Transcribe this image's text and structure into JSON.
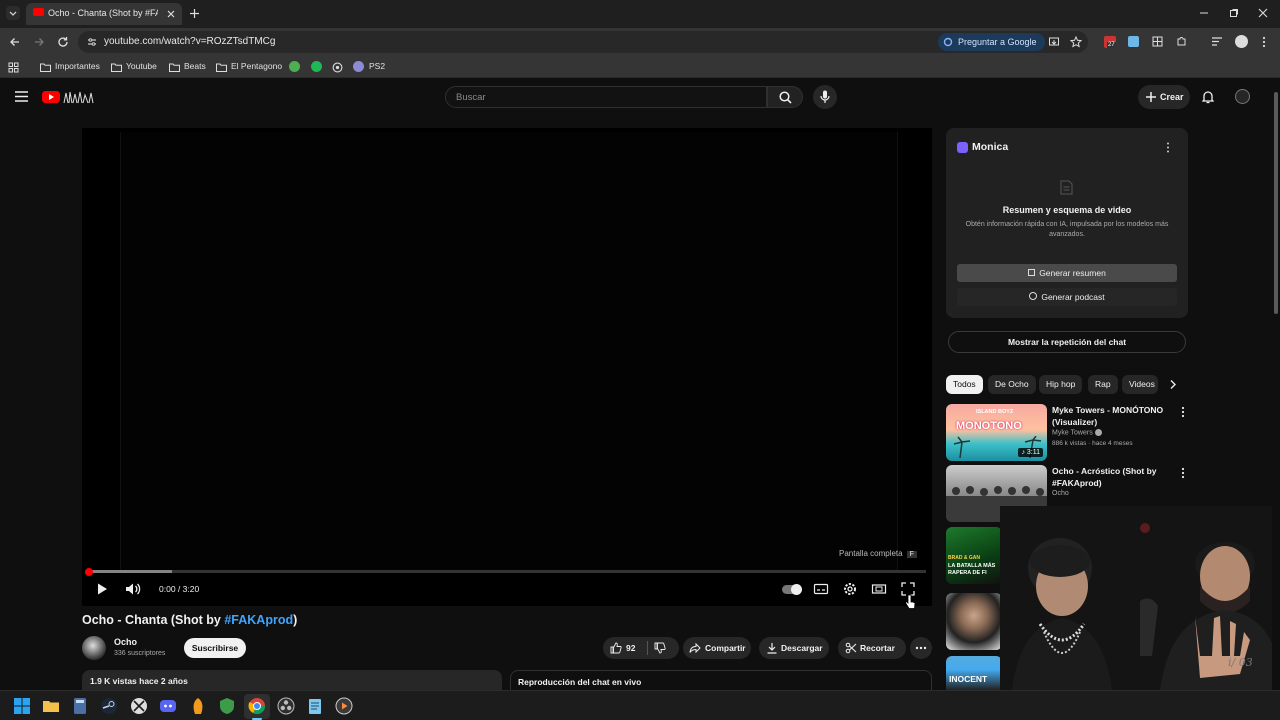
{
  "browser": {
    "tab_title": "Ocho - Chanta (Shot by #FAKAprod)",
    "url": "youtube.com/watch?v=ROzZTsdTMCg",
    "ask_google": "Preguntar a Google",
    "ext_badge": "27",
    "bookmarks": [
      "Importantes",
      "Youtube",
      "Beats",
      "El Pentagono",
      "PS2"
    ]
  },
  "youtube": {
    "search_placeholder": "Buscar",
    "create_label": "Crear"
  },
  "player": {
    "time": "0:00 / 3:20",
    "progress_fraction": 0.0,
    "buffered_fraction": 0.1,
    "fullscreen_tip": "Pantalla completa",
    "fullscreen_key": "F"
  },
  "video": {
    "title_prefix": "Ocho - Chanta (Shot by ",
    "title_tag": "#FAKAprod",
    "title_suffix": ")",
    "channel": "Ocho",
    "subscribers": "336 suscriptores",
    "subscribe": "Suscribirse",
    "likes": "92",
    "share": "Compartir",
    "download": "Descargar",
    "clip": "Recortar",
    "description": "1.9 K vistas  hace 2 años",
    "chat_replay_bar": "Reproducción del chat en vivo"
  },
  "monica": {
    "title": "Monica",
    "heading": "Resumen y esquema de video",
    "description": "Obtén información rápida con IA, impulsada por los modelos más avanzados.",
    "btn_summary": "Generar resumen",
    "btn_podcast": "Generar podcast"
  },
  "sidebar": {
    "chat_replay": "Mostrar la repetición del chat",
    "chips": [
      "Todos",
      "De Ocho",
      "Hip hop",
      "Rap",
      "Videos"
    ],
    "recommendations": [
      {
        "title": "Myke Towers - MONÓTONO (Visualizer)",
        "channel": "Myke Towers",
        "meta": "886 k vistas · hace 4 meses",
        "duration": "3:11",
        "thumb_text": "MONOTONO",
        "thumb_sub": "ISLAND BOYZ"
      },
      {
        "title": "Ocho - Acróstico (Shot by #FAKAprod)",
        "channel": "Ocho",
        "meta": ""
      },
      {
        "thumb_text": "LA BATALLA MÁS RAPERA DE FI",
        "thumb_sub": "BRAD & GAN"
      },
      {
        "thumb_text": ""
      },
      {
        "thumb_text": "INOCENT"
      }
    ]
  },
  "colors": {
    "background": "#0f0f0f",
    "accent_red": "#ff0000",
    "link_blue": "#3ea6ff"
  }
}
